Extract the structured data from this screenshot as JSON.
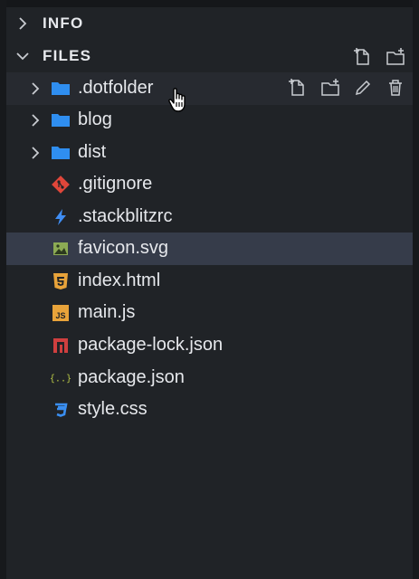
{
  "explorer": {
    "sections": {
      "info": {
        "title": "INFO"
      },
      "files": {
        "title": "FILES"
      }
    },
    "toolbar_icons": [
      "new-file-icon",
      "new-folder-icon"
    ],
    "row_action_icons": [
      "new-file-icon",
      "new-folder-icon",
      "rename-pencil-icon",
      "delete-trash-icon"
    ],
    "items": [
      {
        "name": ".dotfolder",
        "type": "folder",
        "icon": "folder-icon"
      },
      {
        "name": "blog",
        "type": "folder",
        "icon": "folder-icon"
      },
      {
        "name": "dist",
        "type": "folder",
        "icon": "folder-icon"
      },
      {
        "name": ".gitignore",
        "type": "file",
        "icon": "git-icon"
      },
      {
        "name": ".stackblitzrc",
        "type": "file",
        "icon": "lightning-icon"
      },
      {
        "name": "favicon.svg",
        "type": "file",
        "icon": "image-icon",
        "selected": true
      },
      {
        "name": "index.html",
        "type": "file",
        "icon": "html5-icon"
      },
      {
        "name": "main.js",
        "type": "file",
        "icon": "javascript-icon",
        "badge": "JS"
      },
      {
        "name": "package-lock.json",
        "type": "file",
        "icon": "npm-icon"
      },
      {
        "name": "package.json",
        "type": "file",
        "icon": "json-icon",
        "badge": "{..}"
      },
      {
        "name": "style.css",
        "type": "file",
        "icon": "css3-icon"
      }
    ]
  },
  "colors": {
    "folder": "#2f8ef0",
    "git": "#e0463a",
    "lightning": "#3f8ef5",
    "image": "#8cab54",
    "html": "#e8a33a",
    "js": "#e8a33a",
    "npm": "#cf3f3f",
    "json": "#b3c246",
    "css": "#3a8ef0",
    "selected_row": "#363c4a"
  }
}
